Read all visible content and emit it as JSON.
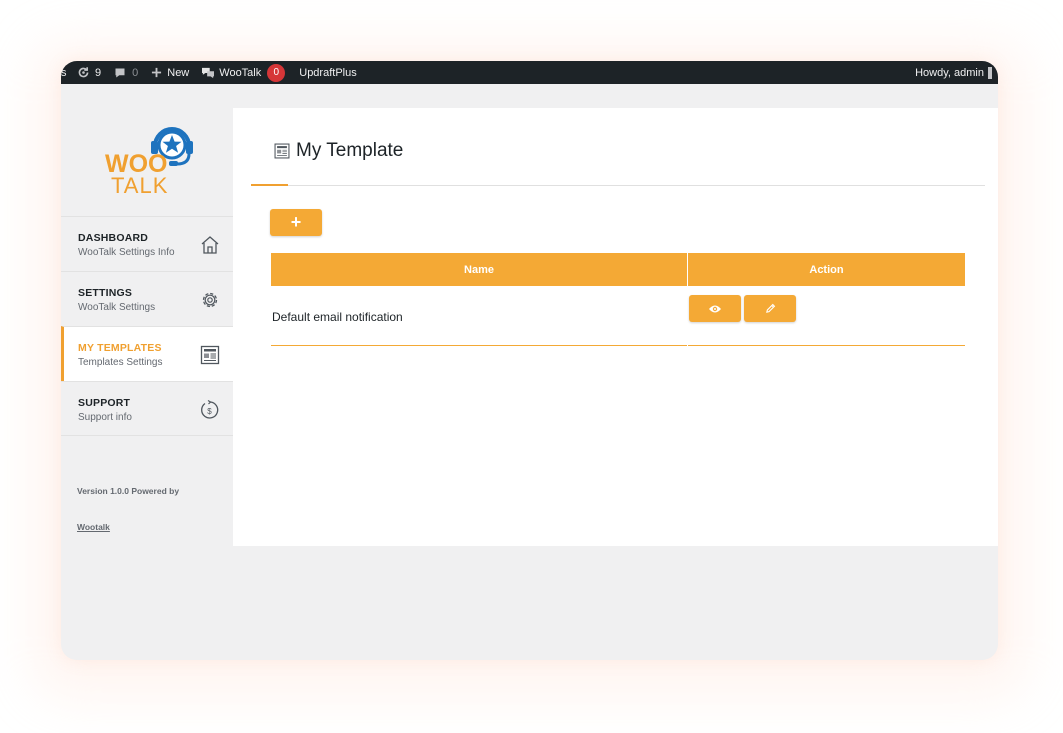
{
  "adminbar": {
    "edge_fragment": "s",
    "updates_count": "9",
    "comments_count": "0",
    "new_label": "New",
    "wootalk_label": "WooTalk",
    "wootalk_badge": "0",
    "updraft_label": "UpdraftPlus",
    "howdy": "Howdy, admin"
  },
  "logo": {
    "line1": "WOO",
    "line2": "TALK"
  },
  "sidebar": {
    "items": [
      {
        "title": "DASHBOARD",
        "subtitle": "WooTalk Settings Info",
        "icon": "home-icon"
      },
      {
        "title": "SETTINGS",
        "subtitle": "WooTalk Settings",
        "icon": "gear-icon"
      },
      {
        "title": "MY TEMPLATES",
        "subtitle": "Templates Settings",
        "icon": "template-icon"
      },
      {
        "title": "SUPPORT",
        "subtitle": "Support info",
        "icon": "support-icon"
      }
    ],
    "active_index": 2,
    "version_text": "Version 1.0.0 Powered by",
    "powered_link": "Wootalk"
  },
  "main": {
    "title": "My Template",
    "add_button": "+",
    "table": {
      "headers": [
        "Name",
        "Action"
      ],
      "rows": [
        {
          "name": "Default email notification",
          "actions": [
            "eye-icon",
            "pencil-icon"
          ]
        }
      ]
    }
  },
  "colors": {
    "accent": "#f4a935",
    "adminbar": "#1d2327",
    "badge": "#d63638",
    "logo_blue": "#1e73be",
    "logo_orange": "#f0a030"
  }
}
